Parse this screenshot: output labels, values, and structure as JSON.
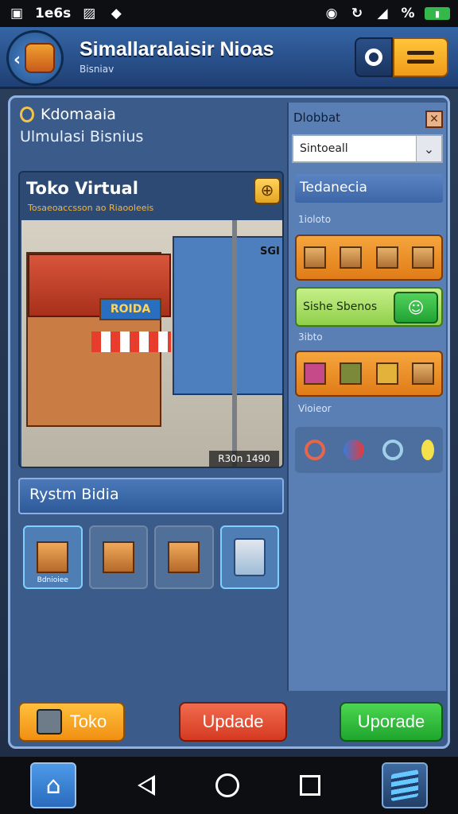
{
  "status": {
    "time": "1e6s"
  },
  "header": {
    "title": "Simallaralaisir Nioas",
    "subtitle": "Bisniav"
  },
  "panel": {
    "heading": "Kdomaaia",
    "subheading": "Ulmulasi Bisnius"
  },
  "store": {
    "title": "Toko Virtual",
    "subtitle": "Tosaeoaccsson ao Riaooleeis",
    "sign": "ROIDA",
    "corner_label": "SGI",
    "price": "R30n 1490"
  },
  "right": {
    "title": "Dlobbat",
    "select_value": "Sintoeall",
    "tab": "Tedanecia",
    "label1": "1ioloto",
    "green_label": "Sishe Sbenos",
    "label2": "3ibto",
    "label3": "Vioieor"
  },
  "subpanel": {
    "title": "Rystm Bidia",
    "items": [
      {
        "label": "Bdnioiee"
      },
      {
        "label": ""
      },
      {
        "label": ""
      },
      {
        "label": ""
      }
    ]
  },
  "buttons": {
    "toko": "Toko",
    "update": "Updade",
    "upgrade": "Uporade"
  },
  "colors": {
    "orange": "#f08f13",
    "green": "#1fa52d",
    "red": "#d43a21",
    "blue": "#3565a5"
  }
}
